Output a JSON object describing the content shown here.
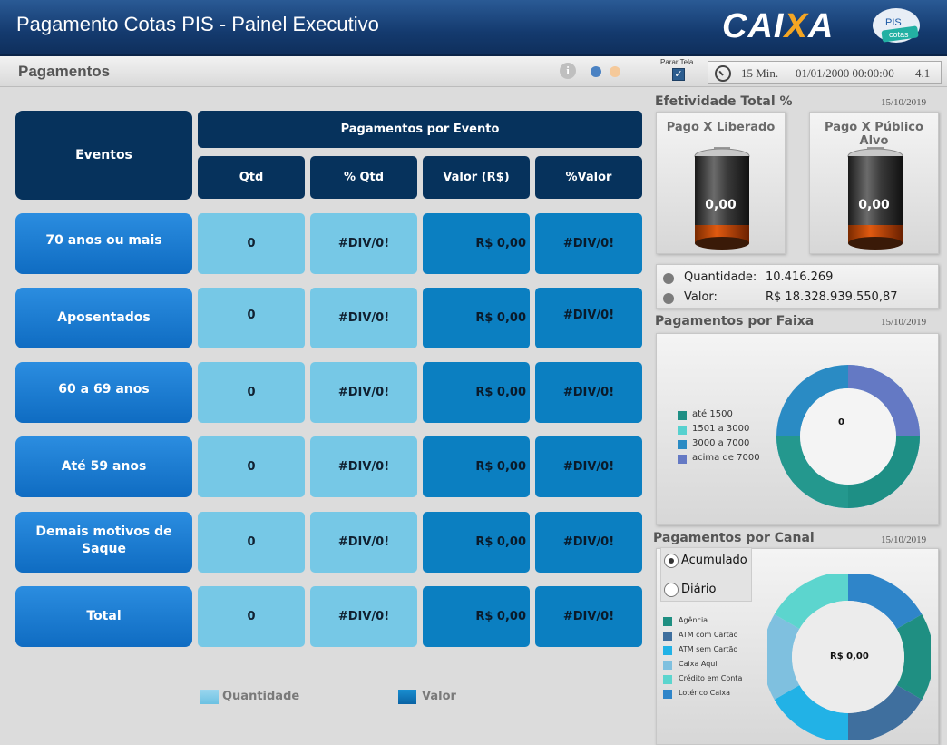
{
  "header": {
    "title": "Pagamento Cotas PIS - Painel Executivo",
    "brand_prefix": "CAI",
    "brand_x": "X",
    "brand_suffix": "A",
    "pis_logo_top": "PIS",
    "pis_logo_bottom": "cotas"
  },
  "subheader": {
    "page_title": "Pagamentos",
    "info_icon": "i",
    "stop_label": "Parar Tela",
    "stop_checked": true,
    "refresh_interval": "15 Min.",
    "datetime": "01/01/2000 00:00:00",
    "version": "4.1"
  },
  "table": {
    "events_header": "Eventos",
    "group_header": "Pagamentos por Evento",
    "columns": [
      "Qtd",
      "% Qtd",
      "Valor (R$)",
      "%Valor"
    ],
    "rows": [
      {
        "event": "70 anos ou mais",
        "qtd": "0",
        "pct_qtd": "#DIV/0!",
        "valor": "R$ 0,00",
        "pct_valor": "#DIV/0!"
      },
      {
        "event": "Aposentados",
        "qtd": "0",
        "pct_qtd": "#DIV/0!",
        "valor": "R$ 0,00",
        "pct_valor": "#DIV/0!"
      },
      {
        "event": "60 a 69 anos",
        "qtd": "0",
        "pct_qtd": "#DIV/0!",
        "valor": "R$ 0,00",
        "pct_valor": "#DIV/0!"
      },
      {
        "event": "Até 59 anos",
        "qtd": "0",
        "pct_qtd": "#DIV/0!",
        "valor": "R$ 0,00",
        "pct_valor": "#DIV/0!"
      },
      {
        "event": "Demais motivos de Saque",
        "qtd": "0",
        "pct_qtd": "#DIV/0!",
        "valor": "R$ 0,00",
        "pct_valor": "#DIV/0!"
      },
      {
        "event": "Total",
        "qtd": "0",
        "pct_qtd": "#DIV/0!",
        "valor": "R$ 0,00",
        "pct_valor": "#DIV/0!"
      }
    ],
    "legend": {
      "quantity_label": "Quantidade",
      "value_label": "Valor"
    }
  },
  "efetividade": {
    "title": "Efetividade Total %",
    "date": "15/10/2019",
    "battery_left": {
      "label": "Pago X Liberado",
      "value": "0,00",
      "level": 0
    },
    "battery_right": {
      "label": "Pago X Público Alvo",
      "value": "0,00",
      "level": 0
    },
    "quantidade_label": "Quantidade:",
    "quantidade_value": "10.416.269",
    "valor_label": "Valor:",
    "valor_value": "R$ 18.328.939.550,87"
  },
  "faixa": {
    "title": "Pagamentos por Faixa",
    "date": "15/10/2019",
    "center_value": "0",
    "legend": [
      {
        "label": "até 1500",
        "color": "#1e8f85"
      },
      {
        "label": "1501 a 3000",
        "color": "#56d1cf"
      },
      {
        "label": "3000 a 7000",
        "color": "#2a8bc4"
      },
      {
        "label": "acima de 7000",
        "color": "#6479c4"
      }
    ]
  },
  "canal": {
    "title": "Pagamentos por Canal",
    "date": "15/10/2019",
    "options": [
      "Acumulado",
      "Diário"
    ],
    "selected": "Acumulado",
    "center_value": "R$ 0,00",
    "legend": [
      {
        "label": "Agência",
        "color": "#1f8f82"
      },
      {
        "label": "ATM com Cartão",
        "color": "#3f6f9e"
      },
      {
        "label": "ATM sem Cartão",
        "color": "#22b2e6"
      },
      {
        "label": "Caixa Aqui",
        "color": "#7fc0df"
      },
      {
        "label": "Crédito em Conta",
        "color": "#5cd5ce"
      },
      {
        "label": "Lotérico Caixa",
        "color": "#2f85c9"
      }
    ]
  }
}
